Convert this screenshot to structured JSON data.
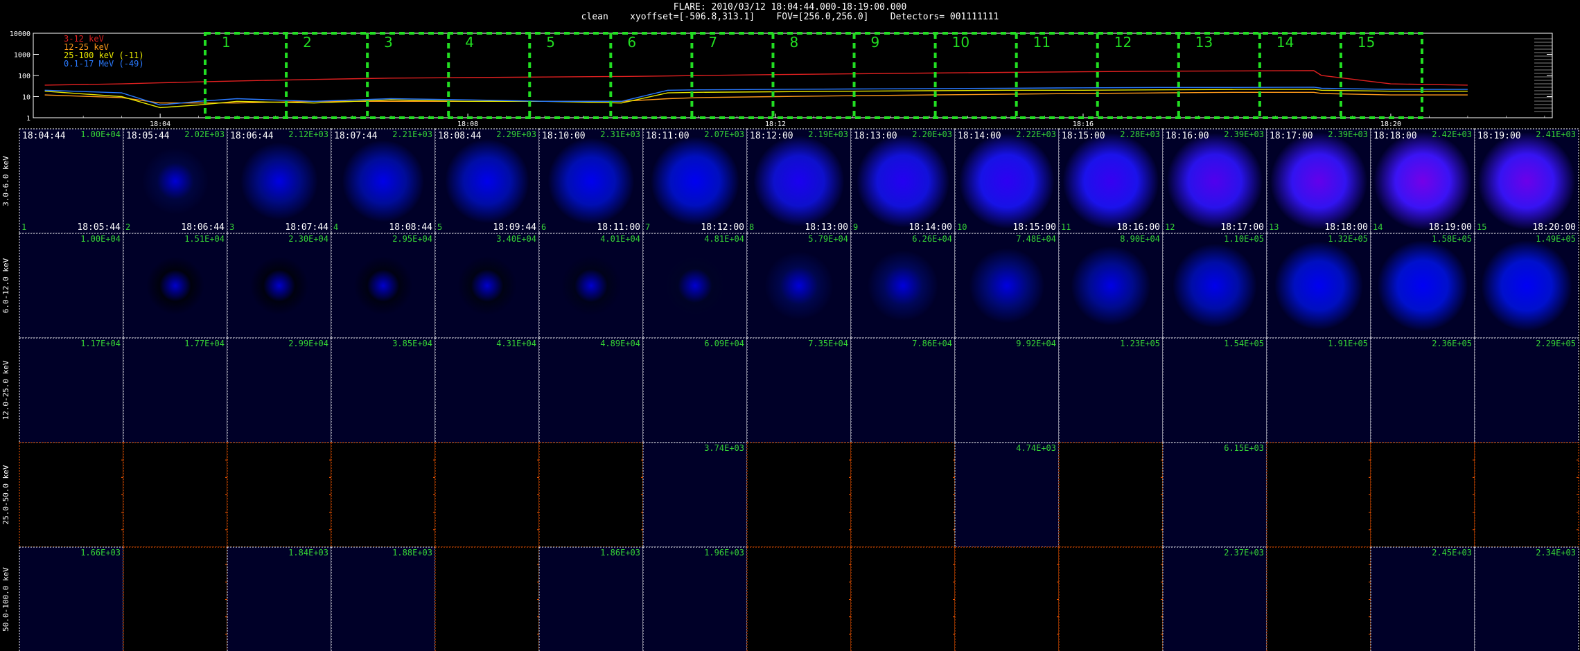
{
  "header": {
    "title": "FLARE: 2010/03/12 18:04:44.000-18:19:00.000",
    "subtitle": "clean    xyoffset=[-506.8,313.1]    FOV=[256.0,256.0]    Detectors= 001111111"
  },
  "lightcurve": {
    "y_ticks": [
      "10000",
      "1000",
      "100",
      "10",
      "1"
    ],
    "x_ticks": [
      "18:04",
      "18:08",
      "18:12",
      "18:16",
      "18:20"
    ],
    "legend": [
      {
        "label": "3-12 keV",
        "color": "#e02020"
      },
      {
        "label": "12-25 keV",
        "color": "#ff9a1a"
      },
      {
        "label": "25-100 keV (-11)",
        "color": "#e8e800"
      },
      {
        "label": "0.1-17 MeV (-49)",
        "color": "#2a7aff"
      }
    ],
    "intervals": [
      "1",
      "2",
      "3",
      "4",
      "5",
      "6",
      "7",
      "8",
      "9",
      "10",
      "11",
      "12",
      "13",
      "14",
      "15"
    ]
  },
  "chart_data": {
    "type": "line",
    "title": "FLARE: 2010/03/12 18:04:44.000-18:19:00.000",
    "xlabel": "",
    "ylabel": "",
    "yscale": "log",
    "ylim": [
      1,
      10000
    ],
    "x_unit": "minutes after 18:00",
    "x": [
      2.5,
      3.5,
      4.0,
      4.5,
      5.0,
      6.0,
      7.0,
      8.0,
      9.0,
      10.0,
      10.6,
      11.0,
      12.0,
      13.0,
      14.0,
      15.0,
      16.0,
      17.0,
      18.0,
      19.0,
      19.1,
      20.0,
      21.0
    ],
    "series": [
      {
        "name": "3-12 keV",
        "color": "#e02020",
        "values": [
          35,
          40,
          45,
          50,
          55,
          65,
          75,
          80,
          85,
          90,
          95,
          100,
          110,
          120,
          130,
          140,
          150,
          160,
          165,
          170,
          100,
          40,
          35
        ]
      },
      {
        "name": "12-25 keV",
        "color": "#ff9a1a",
        "values": [
          12,
          9,
          5,
          5,
          5,
          6,
          6,
          6,
          6,
          6,
          8,
          9,
          10,
          11,
          12,
          13,
          14,
          15,
          16,
          16,
          14,
          12,
          12
        ]
      },
      {
        "name": "25-100 keV (-11)",
        "color": "#e8e800",
        "values": [
          18,
          10,
          3,
          4,
          6,
          5,
          7,
          6,
          6,
          5,
          15,
          16,
          17,
          18,
          19,
          20,
          20,
          21,
          22,
          22,
          20,
          18,
          18
        ]
      },
      {
        "name": "0.1-17 MeV (-49)",
        "color": "#2a7aff",
        "values": [
          20,
          15,
          4,
          6,
          8,
          6,
          8,
          7,
          6,
          6,
          20,
          21,
          22,
          23,
          24,
          25,
          26,
          27,
          27,
          28,
          25,
          22,
          22
        ]
      }
    ]
  },
  "rows": [
    {
      "label": "3.0-6.0 keV",
      "peaks": [
        "1.00E+04",
        "2.02E+03",
        "2.12E+03",
        "2.21E+03",
        "2.29E+03",
        "2.31E+03",
        "2.07E+03",
        "2.19E+03",
        "2.20E+03",
        "2.22E+03",
        "2.28E+03",
        "2.39E+03",
        "2.39E+03",
        "2.42E+03",
        "2.41E+03"
      ],
      "intensity": [
        0.02,
        0.25,
        0.5,
        0.6,
        0.65,
        0.7,
        0.75,
        0.8,
        0.85,
        0.9,
        0.92,
        0.92,
        0.94,
        0.96,
        0.95
      ],
      "red": [
        0,
        0,
        0,
        0,
        0,
        0,
        0,
        0.15,
        0.2,
        0.25,
        0.3,
        0.45,
        0.55,
        0.65,
        0.6
      ]
    },
    {
      "label": "6.0-12.0 keV",
      "peaks": [
        "1.00E+04",
        "1.51E+04",
        "2.30E+04",
        "2.95E+04",
        "3.40E+04",
        "4.01E+04",
        "4.81E+04",
        "5.79E+04",
        "6.26E+04",
        "7.48E+04",
        "8.90E+04",
        "1.10E+05",
        "1.32E+05",
        "1.58E+05",
        "1.49E+05"
      ],
      "intensity": [
        0.02,
        0.05,
        0.06,
        0.07,
        0.08,
        0.1,
        0.15,
        0.3,
        0.35,
        0.45,
        0.55,
        0.65,
        0.75,
        0.8,
        0.8
      ],
      "red": [
        0,
        0,
        0,
        0,
        0,
        0,
        0,
        0,
        0,
        0,
        0,
        0,
        0,
        0,
        0
      ]
    },
    {
      "label": "12.0-25.0 keV",
      "peaks": [
        "1.17E+04",
        "1.77E+04",
        "2.99E+04",
        "3.85E+04",
        "4.31E+04",
        "4.89E+04",
        "6.09E+04",
        "7.35E+04",
        "7.86E+04",
        "9.92E+04",
        "1.23E+05",
        "1.54E+05",
        "1.91E+05",
        "2.36E+05",
        "2.29E+05"
      ],
      "intensity": [
        0.02,
        0.02,
        0.02,
        0.02,
        0.02,
        0.02,
        0.02,
        0.02,
        0.02,
        0.02,
        0.02,
        0.02,
        0.02,
        0.02,
        0.02
      ],
      "red": [
        0,
        0,
        0,
        0,
        0,
        0,
        0,
        0,
        0,
        0,
        0,
        0,
        0,
        0,
        0
      ]
    },
    {
      "label": "25.0-50.0 keV",
      "peaks": [
        "",
        "",
        "",
        "",
        "",
        "",
        "3.74E+03",
        "",
        "",
        "4.74E+03",
        "",
        "6.15E+03",
        "",
        "",
        ""
      ],
      "intensity": [
        0,
        0,
        0,
        0,
        0,
        0,
        0.02,
        0,
        0,
        0.02,
        0,
        0.02,
        0,
        0,
        0
      ],
      "red": [
        0,
        0,
        0,
        0,
        0,
        0,
        0,
        0,
        0,
        0,
        0,
        0,
        0,
        0,
        0
      ]
    },
    {
      "label": "50.0-100.0 keV",
      "peaks": [
        "1.66E+03",
        "",
        "1.84E+03",
        "1.88E+03",
        "",
        "1.86E+03",
        "1.96E+03",
        "",
        "",
        "",
        "",
        "2.37E+03",
        "",
        "2.45E+03",
        "2.34E+03"
      ],
      "intensity": [
        0.02,
        0,
        0.02,
        0.02,
        0,
        0.02,
        0.02,
        0,
        0,
        0,
        0,
        0.02,
        0,
        0.02,
        0.02
      ],
      "red": [
        0,
        0,
        0,
        0,
        0,
        0,
        0,
        0,
        0,
        0,
        0,
        0,
        0,
        0,
        0
      ]
    }
  ],
  "start_times": [
    "18:04:44",
    "18:05:44",
    "18:06:44",
    "18:07:44",
    "18:08:44",
    "18:10:00",
    "18:11:00",
    "18:12:00",
    "18:13:00",
    "18:14:00",
    "18:15:00",
    "18:16:00",
    "18:17:00",
    "18:18:00",
    "18:19:00"
  ],
  "end_times": [
    "18:05:44",
    "18:06:44",
    "18:07:44",
    "18:08:44",
    "18:09:44",
    "18:11:00",
    "18:12:00",
    "18:13:00",
    "18:14:00",
    "18:15:00",
    "18:16:00",
    "18:17:00",
    "18:18:00",
    "18:19:00",
    "18:20:00"
  ],
  "panel_numbers": [
    "1",
    "2",
    "3",
    "4",
    "5",
    "6",
    "7",
    "8",
    "9",
    "10",
    "11",
    "12",
    "13",
    "14",
    "15"
  ],
  "colors": {
    "peak": "#36d536",
    "grid_white": "#ffffff",
    "grid_orange": "#ff5a00",
    "interval_box": "#22dd22"
  }
}
